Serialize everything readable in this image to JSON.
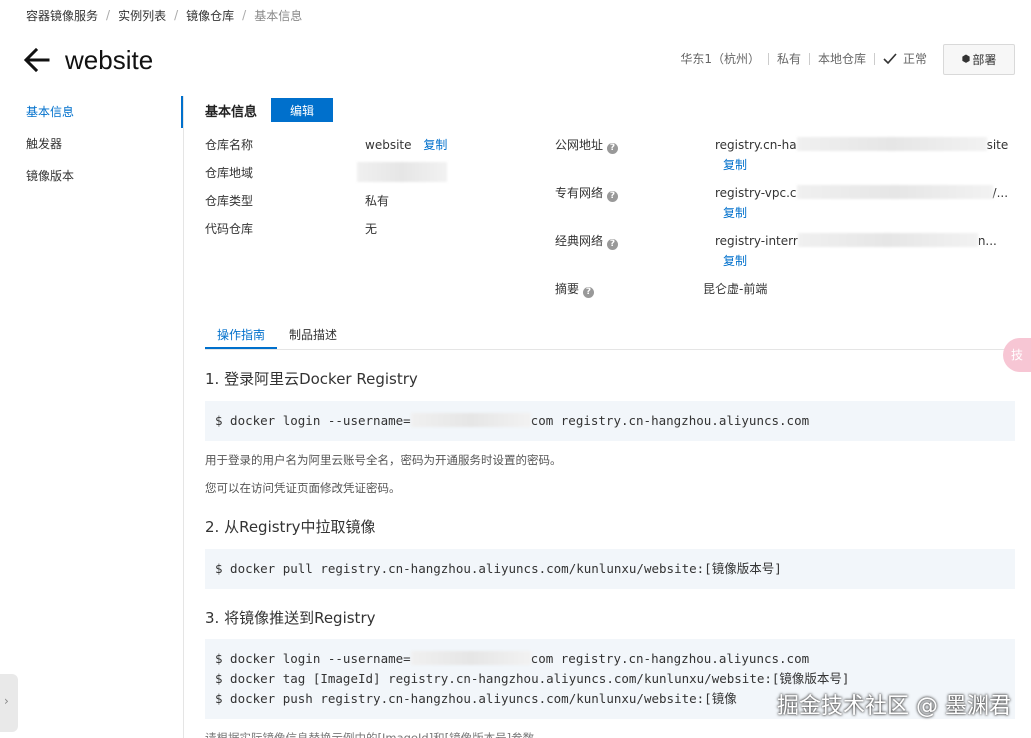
{
  "breadcrumb": [
    "容器镜像服务",
    "实例列表",
    "镜像仓库",
    "基本信息"
  ],
  "header": {
    "title": "website",
    "region": "华东1（杭州）",
    "visibility": "私有",
    "source": "本地仓库",
    "status": "正常",
    "deploy_label": "部署"
  },
  "sidebar": {
    "items": [
      {
        "label": "基本信息",
        "active": true
      },
      {
        "label": "触发器",
        "active": false
      },
      {
        "label": "镜像版本",
        "active": false
      }
    ]
  },
  "basic_info": {
    "section_title": "基本信息",
    "edit_label": "编辑",
    "copy_label": "复制",
    "repo_name_label": "仓库名称",
    "repo_name": "website",
    "region_label": "仓库地域",
    "type_label": "仓库类型",
    "type_value": "私有",
    "code_repo_label": "代码仓库",
    "code_repo_value": "无",
    "public_label": "公网地址",
    "public_prefix": "registry.cn-ha",
    "public_suffix": "site",
    "vpc_label": "专有网络",
    "vpc_prefix": "registry-vpc.c",
    "vpc_suffix": "/...",
    "classic_label": "经典网络",
    "classic_prefix": "registry-interr",
    "classic_suffix": "n...",
    "summary_label": "摘要",
    "summary_value": "昆仑虚-前端"
  },
  "tabs": [
    {
      "label": "操作指南",
      "active": true
    },
    {
      "label": "制品描述",
      "active": false
    }
  ],
  "guide": {
    "step1_title": "1. 登录阿里云Docker Registry",
    "step1_cmd_prefix": "$ docker login --username=",
    "step1_cmd_suffix": "com registry.cn-hangzhou.aliyuncs.com",
    "step1_note1": "用于登录的用户名为阿里云账号全名，密码为开通服务时设置的密码。",
    "step1_note2": "您可以在访问凭证页面修改凭证密码。",
    "step2_title": "2. 从Registry中拉取镜像",
    "step2_cmd": "$ docker pull registry.cn-hangzhou.aliyuncs.com/kunlunxu/website:[镜像版本号]",
    "step3_title": "3. 将镜像推送到Registry",
    "step3_cmd1_prefix": "$ docker login --username=",
    "step3_cmd1_suffix": "com registry.cn-hangzhou.aliyuncs.com",
    "step3_cmd2": "$ docker tag [ImageId] registry.cn-hangzhou.aliyuncs.com/kunlunxu/website:[镜像版本号]",
    "step3_cmd3": "$ docker push registry.cn-hangzhou.aliyuncs.com/kunlunxu/website:[镜像",
    "step3_note": "请根据实际镜像信息替换示例中的[ImageId]和[镜像版本号]参数。"
  },
  "float_badge": "技",
  "watermark": "掘金技术社区 @ 墨渊君",
  "colors": {
    "accent": "#0070cc",
    "code_bg": "#f2f6fa"
  }
}
